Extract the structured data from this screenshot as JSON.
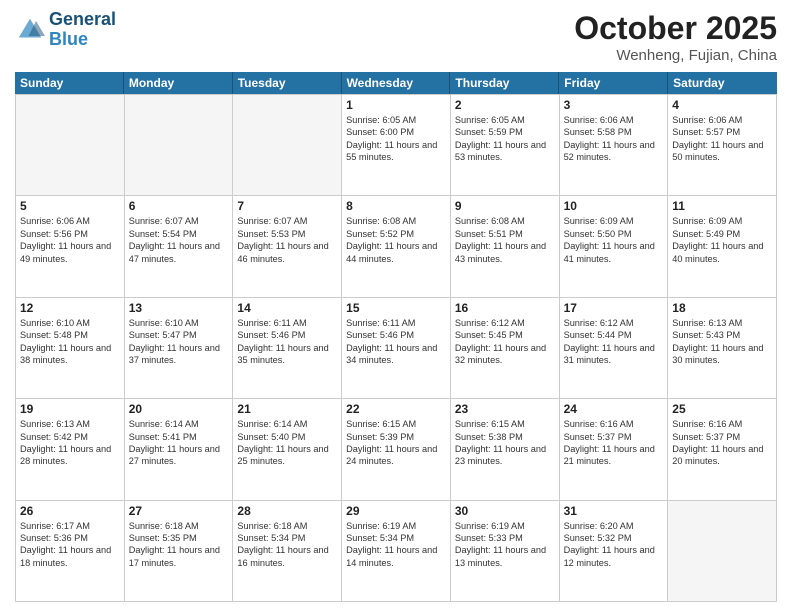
{
  "header": {
    "logo_line1": "General",
    "logo_line2": "Blue",
    "month_title": "October 2025",
    "location": "Wenheng, Fujian, China"
  },
  "weekdays": [
    "Sunday",
    "Monday",
    "Tuesday",
    "Wednesday",
    "Thursday",
    "Friday",
    "Saturday"
  ],
  "weeks": [
    [
      {
        "day": "",
        "sunrise": "",
        "sunset": "",
        "daylight": ""
      },
      {
        "day": "",
        "sunrise": "",
        "sunset": "",
        "daylight": ""
      },
      {
        "day": "",
        "sunrise": "",
        "sunset": "",
        "daylight": ""
      },
      {
        "day": "1",
        "sunrise": "Sunrise: 6:05 AM",
        "sunset": "Sunset: 6:00 PM",
        "daylight": "Daylight: 11 hours and 55 minutes."
      },
      {
        "day": "2",
        "sunrise": "Sunrise: 6:05 AM",
        "sunset": "Sunset: 5:59 PM",
        "daylight": "Daylight: 11 hours and 53 minutes."
      },
      {
        "day": "3",
        "sunrise": "Sunrise: 6:06 AM",
        "sunset": "Sunset: 5:58 PM",
        "daylight": "Daylight: 11 hours and 52 minutes."
      },
      {
        "day": "4",
        "sunrise": "Sunrise: 6:06 AM",
        "sunset": "Sunset: 5:57 PM",
        "daylight": "Daylight: 11 hours and 50 minutes."
      }
    ],
    [
      {
        "day": "5",
        "sunrise": "Sunrise: 6:06 AM",
        "sunset": "Sunset: 5:56 PM",
        "daylight": "Daylight: 11 hours and 49 minutes."
      },
      {
        "day": "6",
        "sunrise": "Sunrise: 6:07 AM",
        "sunset": "Sunset: 5:54 PM",
        "daylight": "Daylight: 11 hours and 47 minutes."
      },
      {
        "day": "7",
        "sunrise": "Sunrise: 6:07 AM",
        "sunset": "Sunset: 5:53 PM",
        "daylight": "Daylight: 11 hours and 46 minutes."
      },
      {
        "day": "8",
        "sunrise": "Sunrise: 6:08 AM",
        "sunset": "Sunset: 5:52 PM",
        "daylight": "Daylight: 11 hours and 44 minutes."
      },
      {
        "day": "9",
        "sunrise": "Sunrise: 6:08 AM",
        "sunset": "Sunset: 5:51 PM",
        "daylight": "Daylight: 11 hours and 43 minutes."
      },
      {
        "day": "10",
        "sunrise": "Sunrise: 6:09 AM",
        "sunset": "Sunset: 5:50 PM",
        "daylight": "Daylight: 11 hours and 41 minutes."
      },
      {
        "day": "11",
        "sunrise": "Sunrise: 6:09 AM",
        "sunset": "Sunset: 5:49 PM",
        "daylight": "Daylight: 11 hours and 40 minutes."
      }
    ],
    [
      {
        "day": "12",
        "sunrise": "Sunrise: 6:10 AM",
        "sunset": "Sunset: 5:48 PM",
        "daylight": "Daylight: 11 hours and 38 minutes."
      },
      {
        "day": "13",
        "sunrise": "Sunrise: 6:10 AM",
        "sunset": "Sunset: 5:47 PM",
        "daylight": "Daylight: 11 hours and 37 minutes."
      },
      {
        "day": "14",
        "sunrise": "Sunrise: 6:11 AM",
        "sunset": "Sunset: 5:46 PM",
        "daylight": "Daylight: 11 hours and 35 minutes."
      },
      {
        "day": "15",
        "sunrise": "Sunrise: 6:11 AM",
        "sunset": "Sunset: 5:46 PM",
        "daylight": "Daylight: 11 hours and 34 minutes."
      },
      {
        "day": "16",
        "sunrise": "Sunrise: 6:12 AM",
        "sunset": "Sunset: 5:45 PM",
        "daylight": "Daylight: 11 hours and 32 minutes."
      },
      {
        "day": "17",
        "sunrise": "Sunrise: 6:12 AM",
        "sunset": "Sunset: 5:44 PM",
        "daylight": "Daylight: 11 hours and 31 minutes."
      },
      {
        "day": "18",
        "sunrise": "Sunrise: 6:13 AM",
        "sunset": "Sunset: 5:43 PM",
        "daylight": "Daylight: 11 hours and 30 minutes."
      }
    ],
    [
      {
        "day": "19",
        "sunrise": "Sunrise: 6:13 AM",
        "sunset": "Sunset: 5:42 PM",
        "daylight": "Daylight: 11 hours and 28 minutes."
      },
      {
        "day": "20",
        "sunrise": "Sunrise: 6:14 AM",
        "sunset": "Sunset: 5:41 PM",
        "daylight": "Daylight: 11 hours and 27 minutes."
      },
      {
        "day": "21",
        "sunrise": "Sunrise: 6:14 AM",
        "sunset": "Sunset: 5:40 PM",
        "daylight": "Daylight: 11 hours and 25 minutes."
      },
      {
        "day": "22",
        "sunrise": "Sunrise: 6:15 AM",
        "sunset": "Sunset: 5:39 PM",
        "daylight": "Daylight: 11 hours and 24 minutes."
      },
      {
        "day": "23",
        "sunrise": "Sunrise: 6:15 AM",
        "sunset": "Sunset: 5:38 PM",
        "daylight": "Daylight: 11 hours and 23 minutes."
      },
      {
        "day": "24",
        "sunrise": "Sunrise: 6:16 AM",
        "sunset": "Sunset: 5:37 PM",
        "daylight": "Daylight: 11 hours and 21 minutes."
      },
      {
        "day": "25",
        "sunrise": "Sunrise: 6:16 AM",
        "sunset": "Sunset: 5:37 PM",
        "daylight": "Daylight: 11 hours and 20 minutes."
      }
    ],
    [
      {
        "day": "26",
        "sunrise": "Sunrise: 6:17 AM",
        "sunset": "Sunset: 5:36 PM",
        "daylight": "Daylight: 11 hours and 18 minutes."
      },
      {
        "day": "27",
        "sunrise": "Sunrise: 6:18 AM",
        "sunset": "Sunset: 5:35 PM",
        "daylight": "Daylight: 11 hours and 17 minutes."
      },
      {
        "day": "28",
        "sunrise": "Sunrise: 6:18 AM",
        "sunset": "Sunset: 5:34 PM",
        "daylight": "Daylight: 11 hours and 16 minutes."
      },
      {
        "day": "29",
        "sunrise": "Sunrise: 6:19 AM",
        "sunset": "Sunset: 5:34 PM",
        "daylight": "Daylight: 11 hours and 14 minutes."
      },
      {
        "day": "30",
        "sunrise": "Sunrise: 6:19 AM",
        "sunset": "Sunset: 5:33 PM",
        "daylight": "Daylight: 11 hours and 13 minutes."
      },
      {
        "day": "31",
        "sunrise": "Sunrise: 6:20 AM",
        "sunset": "Sunset: 5:32 PM",
        "daylight": "Daylight: 11 hours and 12 minutes."
      },
      {
        "day": "",
        "sunrise": "",
        "sunset": "",
        "daylight": ""
      }
    ]
  ]
}
